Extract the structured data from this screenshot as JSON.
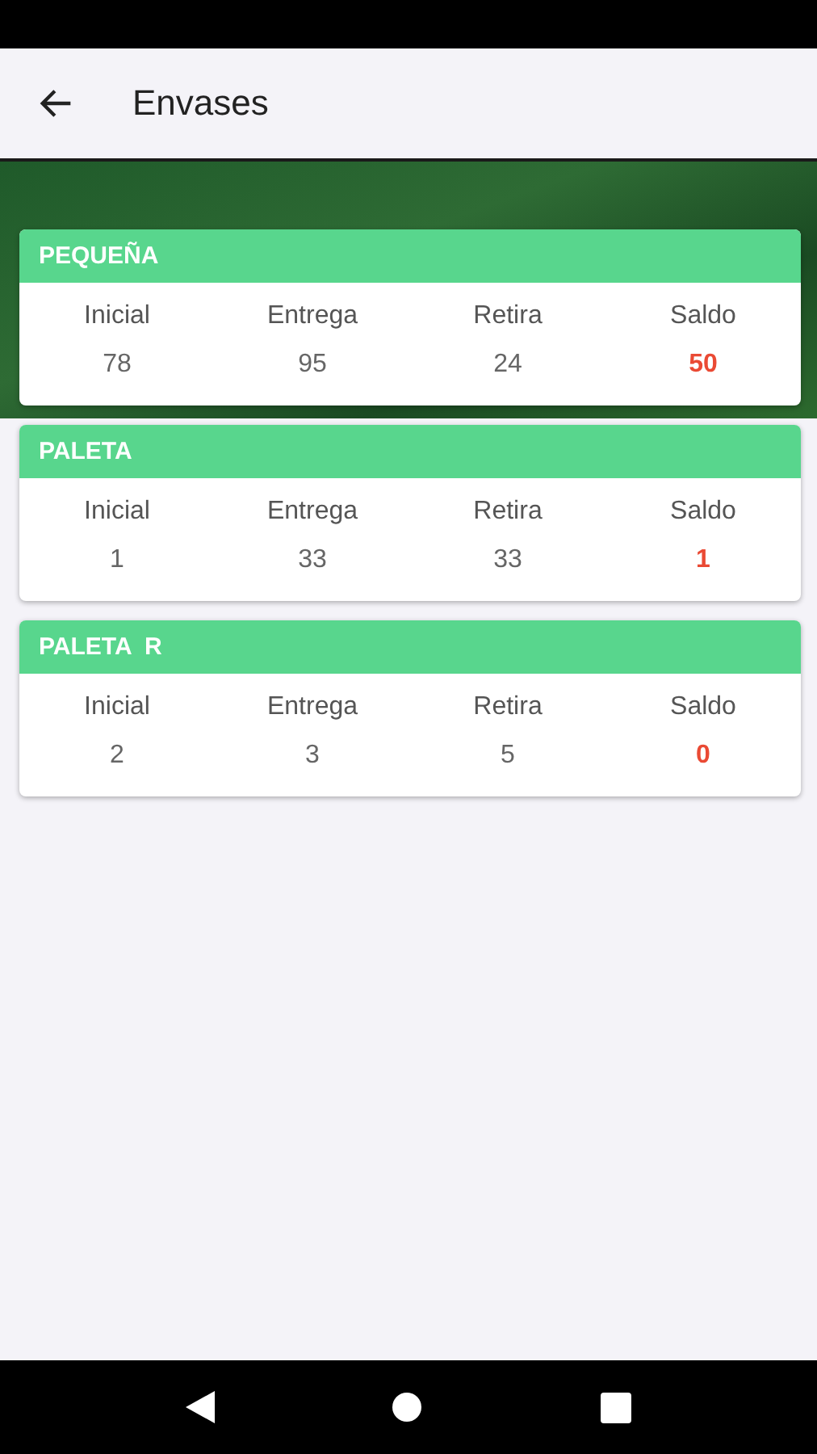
{
  "app_bar": {
    "title": "Envases"
  },
  "cards": [
    {
      "title": "PEQUEÑA",
      "columns": [
        {
          "label": "Inicial",
          "value": "78",
          "highlighted": false
        },
        {
          "label": "Entrega",
          "value": "95",
          "highlighted": false
        },
        {
          "label": "Retira",
          "value": "24",
          "highlighted": false
        },
        {
          "label": "Saldo",
          "value": "50",
          "highlighted": true
        }
      ]
    },
    {
      "title": "PALETA",
      "columns": [
        {
          "label": "Inicial",
          "value": "1",
          "highlighted": false
        },
        {
          "label": "Entrega",
          "value": "33",
          "highlighted": false
        },
        {
          "label": "Retira",
          "value": "33",
          "highlighted": false
        },
        {
          "label": "Saldo",
          "value": "1",
          "highlighted": true
        }
      ]
    },
    {
      "title": "PALETA  R",
      "columns": [
        {
          "label": "Inicial",
          "value": "2",
          "highlighted": false
        },
        {
          "label": "Entrega",
          "value": "3",
          "highlighted": false
        },
        {
          "label": "Retira",
          "value": "5",
          "highlighted": false
        },
        {
          "label": "Saldo",
          "value": "0",
          "highlighted": true
        }
      ]
    }
  ]
}
